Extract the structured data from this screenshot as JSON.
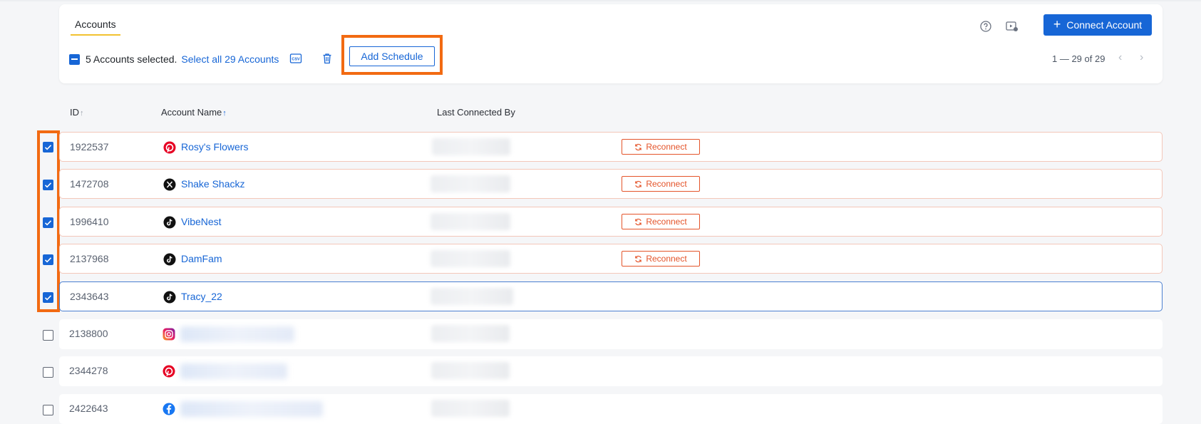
{
  "header": {
    "tab_label": "Accounts",
    "connect_button": "Connect Account",
    "selected_text": "5 Accounts selected.",
    "select_all_link": "Select all 29 Accounts",
    "add_schedule_button": "Add Schedule",
    "pager_text": "1 — 29 of 29"
  },
  "table": {
    "columns": [
      "ID",
      "Account Name",
      "Last Connected By"
    ],
    "reconnect_label": "Reconnect",
    "rows": [
      {
        "id": "1922537",
        "network": "pinterest",
        "name": "Rosy's Flowers",
        "checked": true,
        "needs_reconnect": true
      },
      {
        "id": "1472708",
        "network": "x",
        "name": "Shake Shackz",
        "checked": true,
        "needs_reconnect": true
      },
      {
        "id": "1996410",
        "network": "tiktok",
        "name": "VibeNest",
        "checked": true,
        "needs_reconnect": true
      },
      {
        "id": "2137968",
        "network": "tiktok",
        "name": "DamFam",
        "checked": true,
        "needs_reconnect": true
      },
      {
        "id": "2343643",
        "network": "tiktok",
        "name": "Tracy_22",
        "checked": true,
        "needs_reconnect": false
      },
      {
        "id": "2138800",
        "network": "instagram",
        "name": "",
        "checked": false,
        "needs_reconnect": false
      },
      {
        "id": "2344278",
        "network": "pinterest",
        "name": "",
        "checked": false,
        "needs_reconnect": false
      },
      {
        "id": "2422643",
        "network": "facebook",
        "name": "",
        "checked": false,
        "needs_reconnect": false
      }
    ]
  },
  "colors": {
    "accent": "#1766d6",
    "highlight": "#f26a12",
    "warning": "#e4542a",
    "tab_underline": "#f2c230"
  },
  "icons": [
    "help-icon",
    "video-settings-icon",
    "csv-icon",
    "trash-icon",
    "pinterest-icon",
    "x-icon",
    "tiktok-icon",
    "instagram-icon",
    "facebook-icon",
    "reconnect-icon"
  ]
}
